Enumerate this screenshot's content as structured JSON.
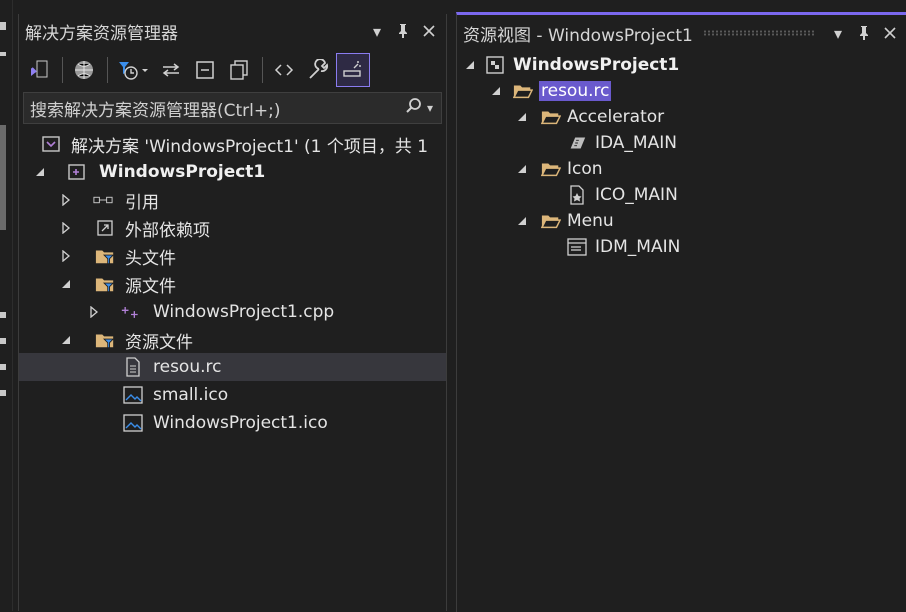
{
  "solution_explorer": {
    "title": "解决方案资源管理器",
    "search_placeholder": "搜索解决方案资源管理器(Ctrl+;)",
    "solution_label": "解决方案 'WindowsProject1' (1 个项目，共 1",
    "project_label": "WindowsProject1",
    "items": [
      {
        "label": "引用"
      },
      {
        "label": "外部依赖项"
      },
      {
        "label": "头文件"
      },
      {
        "label": "源文件"
      },
      {
        "label": "WindowsProject1.cpp"
      },
      {
        "label": "资源文件"
      },
      {
        "label": "resou.rc"
      },
      {
        "label": "small.ico"
      },
      {
        "label": "WindowsProject1.ico"
      }
    ]
  },
  "resource_view": {
    "title": "资源视图 - WindowsProject1",
    "project_label": "WindowsProject1",
    "rc_label": "resou.rc",
    "folders": [
      {
        "label": "Accelerator",
        "child": "IDA_MAIN"
      },
      {
        "label": "Icon",
        "child": "ICO_MAIN"
      },
      {
        "label": "Menu",
        "child": "IDM_MAIN"
      }
    ]
  },
  "colors": {
    "accent": "#7b68ee",
    "folder": "#dcb67a",
    "filter": "#3b8eea",
    "project": "#b180d7"
  }
}
